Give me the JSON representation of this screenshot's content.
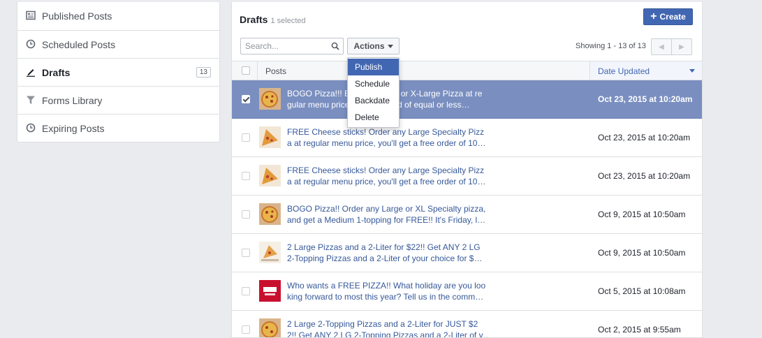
{
  "sidebar": {
    "items": [
      {
        "label": "Published Posts",
        "icon": "published-posts-icon"
      },
      {
        "label": "Scheduled Posts",
        "icon": "clock-icon"
      },
      {
        "label": "Drafts",
        "icon": "pencil-icon",
        "badge": "13",
        "active": true
      },
      {
        "label": "Forms Library",
        "icon": "filter-icon"
      },
      {
        "label": "Expiring Posts",
        "icon": "clock-icon"
      }
    ]
  },
  "header": {
    "title": "Drafts",
    "subtitle": "1 selected",
    "create_label": "Create"
  },
  "toolbar": {
    "search_placeholder": "Search...",
    "actions_label": "Actions",
    "showing": "Showing 1 - 13 of 13"
  },
  "actions_menu": [
    "Publish",
    "Schedule",
    "Backdate",
    "Delete"
  ],
  "table": {
    "col_posts": "Posts",
    "col_date": "Date Updated",
    "rows": [
      {
        "line1": "BOGO Pizza!!! Buy any Large or X-Large Pizza at re",
        "line2": "gular menu price, get a second of equal or less…",
        "date": "Oct 23, 2015 at 10:20am",
        "selected": true,
        "thumb": "pizza"
      },
      {
        "line1": "FREE Cheese sticks! Order any Large Specialty Pizz",
        "line2": "a at regular menu price, you'll get a free order of 10…",
        "date": "Oct 23, 2015 at 10:20am",
        "selected": false,
        "thumb": "pizza"
      },
      {
        "line1": "FREE Cheese sticks! Order any Large Specialty Pizz",
        "line2": "a at regular menu price, you'll get a free order of 10…",
        "date": "Oct 23, 2015 at 10:20am",
        "selected": false,
        "thumb": "pizza"
      },
      {
        "line1": "BOGO Pizza!! Order any Large or XL Specialty pizza,",
        "line2": "and get a Medium 1-topping for FREE!! It's Friday, l…",
        "date": "Oct 9, 2015 at 10:50am",
        "selected": false,
        "thumb": "pizza"
      },
      {
        "line1": "2 Large Pizzas and a 2-Liter for $22!! Get ANY 2 LG",
        "line2": "2-Topping Pizzas and a 2-Liter of your choice for $…",
        "date": "Oct 9, 2015 at 10:50am",
        "selected": false,
        "thumb": "pizza-slice"
      },
      {
        "line1": "Who wants a FREE PIZZA!! What holiday are you loo",
        "line2": "king forward to most this year? Tell us in the comm…",
        "date": "Oct 5, 2015 at 10:08am",
        "selected": false,
        "thumb": "logo"
      },
      {
        "line1": "2 Large 2-Topping Pizzas and a 2-Liter for JUST $2",
        "line2": "2!! Get ANY 2 LG 2-Topping Pizzas and a 2-Liter of y…",
        "date": "Oct 2, 2015 at 9:55am",
        "selected": false,
        "thumb": "pizza"
      }
    ]
  },
  "colors": {
    "accent": "#4267b2",
    "selected_row": "#7a8fc0",
    "background": "#e9ebee"
  }
}
